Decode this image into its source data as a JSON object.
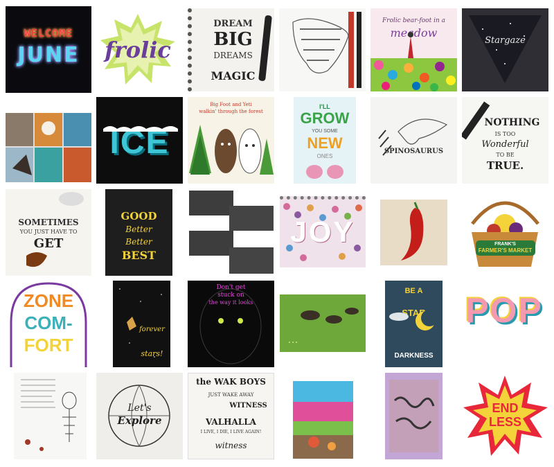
{
  "tiles": {
    "welcome": {
      "line1": "WELCOME",
      "line2": "JUNE"
    },
    "frolic": {
      "word": "frolic"
    },
    "dream": {
      "l1": "DREAM",
      "l2": "BIG",
      "l3": "DREAMS",
      "l4": "MAGIC"
    },
    "meadow": {
      "line": "Frolic bear-foot in a",
      "word": "meadow"
    },
    "stargaze": {
      "word": "Stargaze"
    },
    "ice": {
      "word": "ICE"
    },
    "bigfoot": {
      "line1": "Big Foot and Yeti",
      "line2": "walkin' through the forest"
    },
    "grow": {
      "l1": "I'LL",
      "l2": "GROW",
      "l3": "YOU SOME",
      "l4": "NEW",
      "l5": "ONES"
    },
    "dino": {
      "word": "SPINOSAURUS"
    },
    "nothing": {
      "l1": "NOTHING",
      "l2": "IS TOO",
      "l3": "Wonderful",
      "l4": "TO BE",
      "l5": "TRUE."
    },
    "sometimes": {
      "l1": "SOMETIMES",
      "l2": "YOU JUST HAVE TO",
      "l3": "GET"
    },
    "good": {
      "l1": "GOOD",
      "l2": "Better",
      "l3": "Better",
      "l4": "BEST"
    },
    "joy": {
      "word": "JOY"
    },
    "market": {
      "l1": "FRANK'S",
      "l2": "FARMER'S MARKET"
    },
    "comfort": {
      "l1": "ZONE",
      "l2": "COM-",
      "l3": "FORT"
    },
    "forever": {
      "l1": "forever",
      "l2": "stars!"
    },
    "face": {
      "l1": "Don't get",
      "l2": "stuck on",
      "l3": "the way it looks"
    },
    "dark": {
      "l1": "BE A",
      "l2": "STAR",
      "l3": "DARKNESS"
    },
    "pop": {
      "word": "POP"
    },
    "explore": {
      "l1": "Let's",
      "l2": "Explore"
    },
    "wak": {
      "l1": "the WAK BOYS",
      "l2": "WITNESS",
      "l3": "VALHALLA",
      "l4": "witness",
      "l5": "JUST WAKE AWAY",
      "l6": "I LIVE, I DIE, I LIVE AGAIN!"
    },
    "endless": {
      "l1": "END",
      "l2": "LESS"
    }
  },
  "colors": {
    "orange": "#f08a24",
    "teal": "#3bb0b8",
    "yellow": "#f3d23a",
    "magenta": "#d6247a",
    "dark": "#1b1b1b"
  }
}
